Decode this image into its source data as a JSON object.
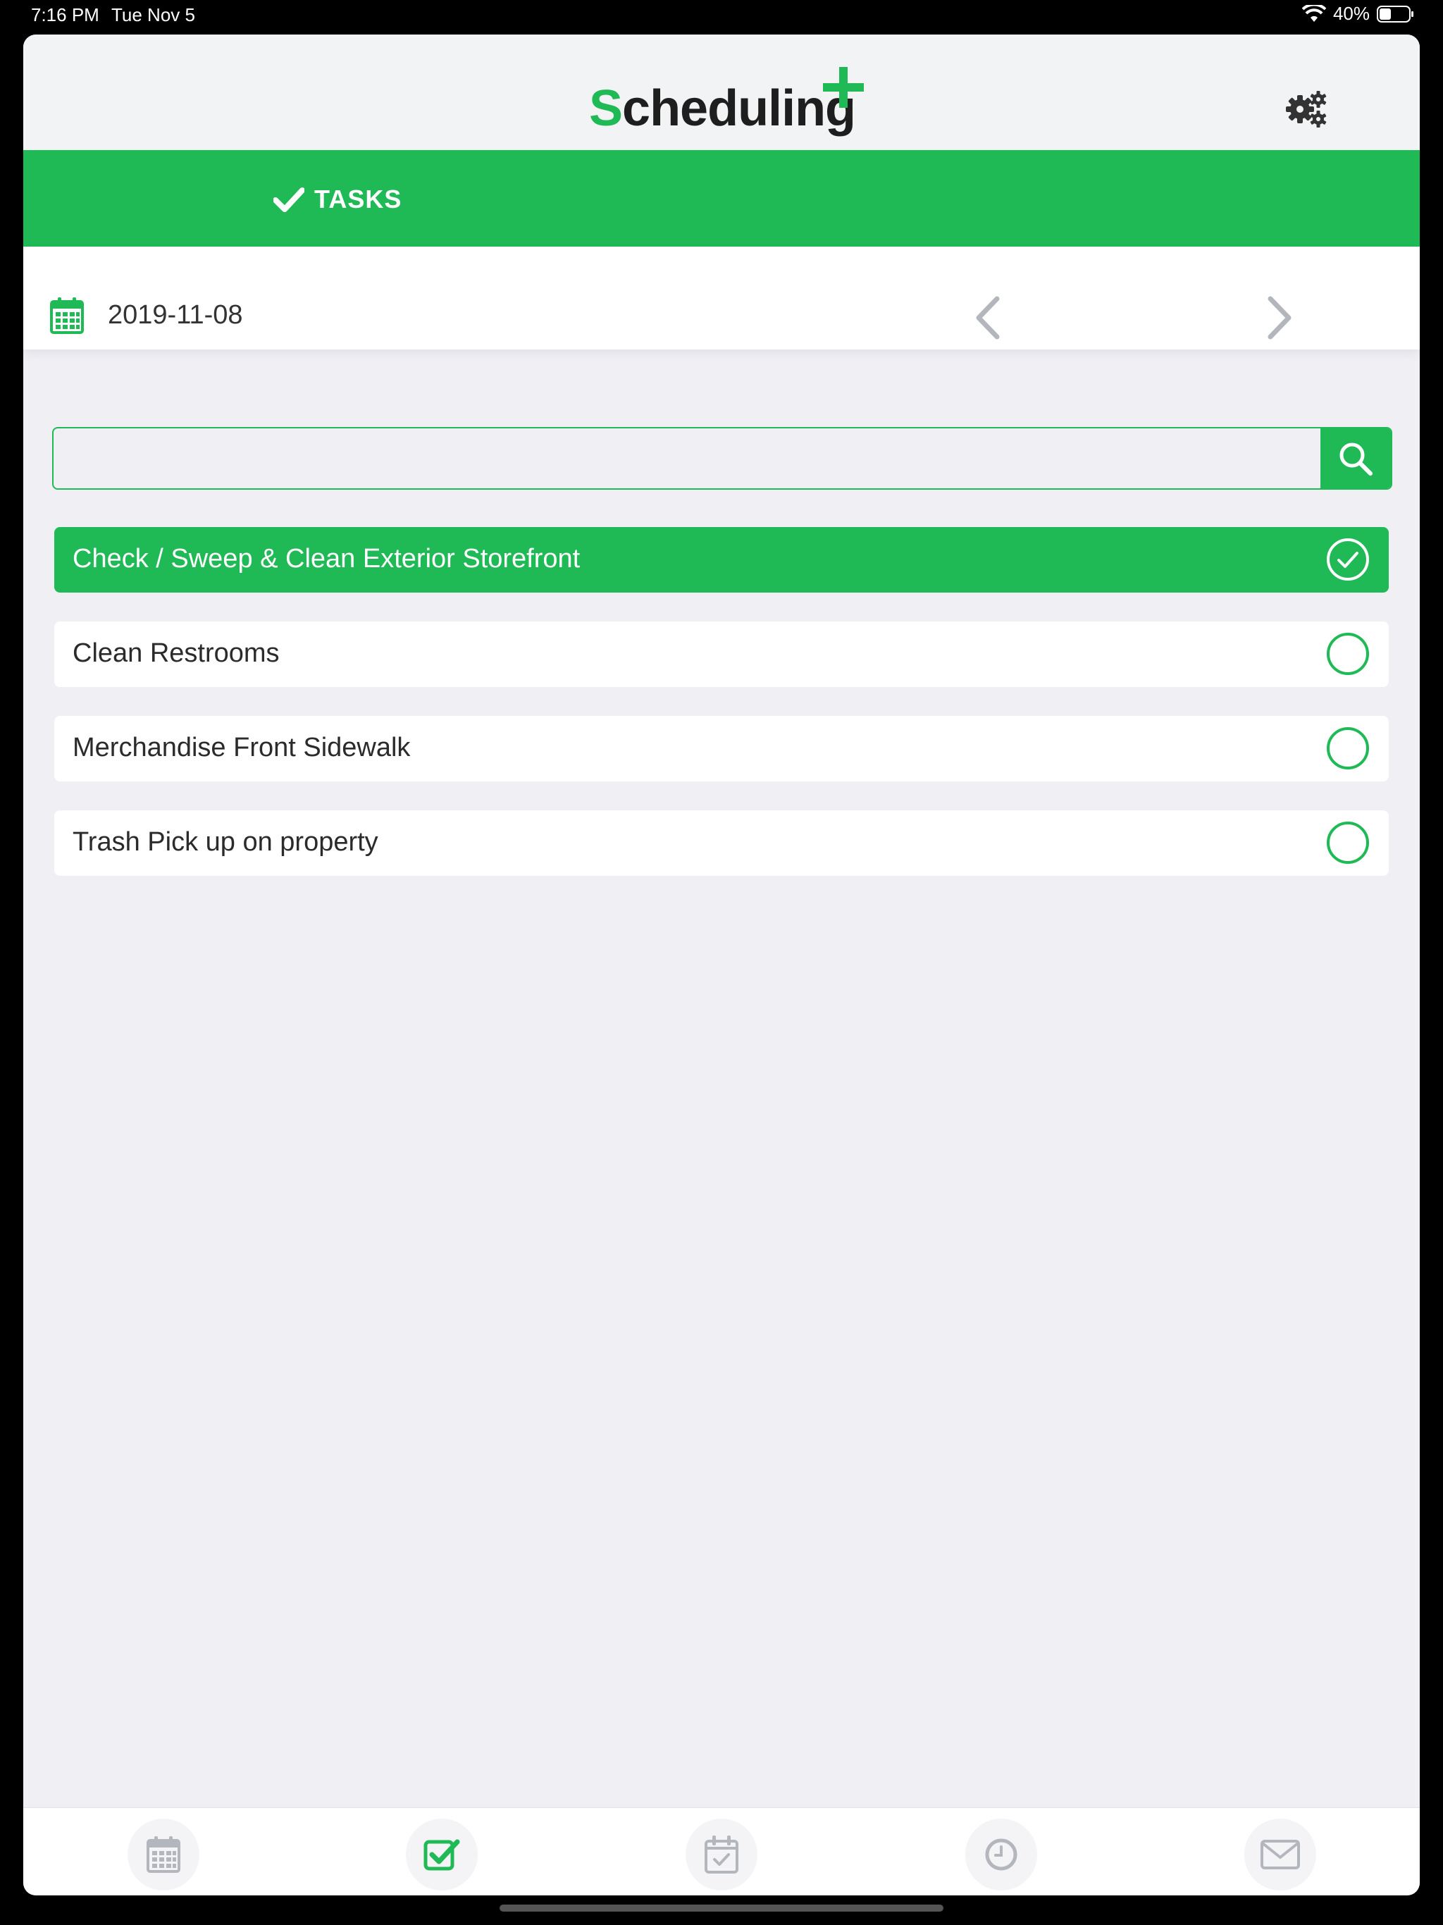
{
  "status_bar": {
    "time": "7:16 PM",
    "date": "Tue Nov 5",
    "battery": "40%"
  },
  "header": {
    "logo_first": "S",
    "logo_rest": "cheduling"
  },
  "top_tab": {
    "label": "TASKS"
  },
  "date_row": {
    "date": "2019-11-08"
  },
  "search": {
    "placeholder": ""
  },
  "tasks": [
    {
      "label": "Check / Sweep & Clean Exterior Storefront",
      "done": true
    },
    {
      "label": "Clean Restrooms",
      "done": false
    },
    {
      "label": "Merchandise Front Sidewalk",
      "done": false
    },
    {
      "label": "Trash Pick up on property",
      "done": false
    }
  ],
  "colors": {
    "brand_green": "#1fb955",
    "nav_gray": "#b3b6bd"
  },
  "bottom_nav": [
    {
      "icon": "calendar-icon",
      "active": false
    },
    {
      "icon": "check-square-icon",
      "active": true
    },
    {
      "icon": "calendar-check-icon",
      "active": false
    },
    {
      "icon": "clock-icon",
      "active": false
    },
    {
      "icon": "mail-icon",
      "active": false
    }
  ]
}
